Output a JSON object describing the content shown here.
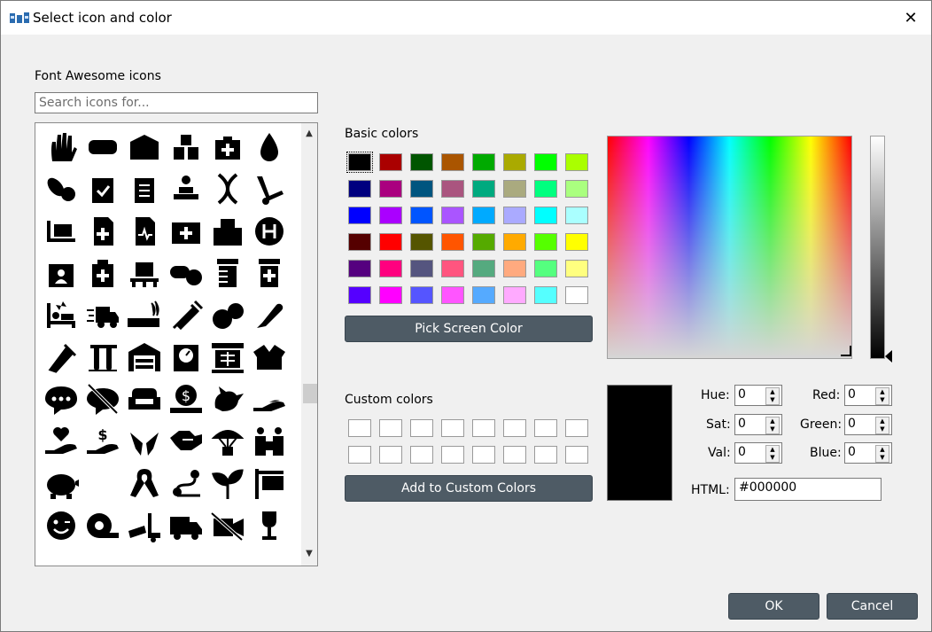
{
  "window": {
    "title": "Select icon and color",
    "close_glyph": "✕"
  },
  "icons_section": {
    "label": "Font Awesome icons",
    "search_placeholder": "Search icons for...",
    "icons": [
      "hand-dots-icon",
      "band-aid-icon",
      "box-icon",
      "boxes-icon",
      "first-aid-kit-icon",
      "tint-icon",
      "capsules-icon",
      "clipboard-check-icon",
      "clipboard-list-icon",
      "diagnoses-icon",
      "dna-icon",
      "dolly-icon",
      "dolly-flatbed-icon",
      "file-medical-icon",
      "file-medical-alt-icon",
      "first-aid-icon",
      "hospital-icon",
      "hospital-symbol-icon",
      "id-card-alt-icon",
      "notes-medical-icon",
      "pallet-icon",
      "pills-icon",
      "prescription-bottle-icon",
      "prescription-bottle-alt-icon",
      "procedures-icon",
      "shipping-fast-icon",
      "smoking-icon",
      "syringe-icon",
      "tablets-icon",
      "thermometer-icon",
      "vial-icon",
      "vials-icon",
      "warehouse-icon",
      "weight-icon",
      "x-ray-icon",
      "box-open-icon",
      "comment-dots-icon",
      "comment-slash-icon",
      "couch-icon",
      "donate-icon",
      "dove-icon",
      "hand-holding-icon",
      "hand-holding-heart-icon",
      "hand-holding-usd-icon",
      "hands-icon",
      "handshake-icon",
      "parachute-box-icon",
      "people-carry-icon",
      "piggy-bank-icon",
      "blank-icon",
      "ribbon-icon",
      "route-icon",
      "seedling-icon",
      "sign-icon",
      "smile-wink-icon",
      "tape-icon",
      "truck-loading-icon",
      "truck-moving-icon",
      "video-slash-icon",
      "wine-glass-icon"
    ],
    "scroll_up": "▲",
    "scroll_down": "▼"
  },
  "basic_colors": {
    "label": "Basic colors",
    "colors": [
      [
        "#000000",
        "#aa0000",
        "#005500",
        "#aa5500",
        "#00aa00",
        "#aaaa00",
        "#00ff00",
        "#aaff00"
      ],
      [
        "#00007f",
        "#aa007f",
        "#00557f",
        "#aa557f",
        "#00aa7f",
        "#aaaa7f",
        "#00ff7f",
        "#aaff7f"
      ],
      [
        "#0000ff",
        "#aa00ff",
        "#0055ff",
        "#aa55ff",
        "#00aaff",
        "#aaaaff",
        "#00ffff",
        "#aaffff"
      ],
      [
        "#550000",
        "#ff0000",
        "#555500",
        "#ff5500",
        "#55aa00",
        "#ffaa00",
        "#55ff00",
        "#ffff00"
      ],
      [
        "#55007f",
        "#ff007f",
        "#55557f",
        "#ff557f",
        "#55aa7f",
        "#ffaa7f",
        "#55ff7f",
        "#ffff7f"
      ],
      [
        "#5500ff",
        "#ff00ff",
        "#5555ff",
        "#ff55ff",
        "#55aaff",
        "#ffaaff",
        "#55ffff",
        "#ffffff"
      ]
    ],
    "selected": "#000000"
  },
  "pick_screen_color_label": "Pick Screen Color",
  "custom_colors": {
    "label": "Custom colors",
    "rows": 2,
    "cols": 8
  },
  "add_custom_label": "Add to Custom Colors",
  "fields": {
    "hue": {
      "label": "Hue:",
      "value": "0"
    },
    "sat": {
      "label": "Sat:",
      "value": "0"
    },
    "val": {
      "label": "Val:",
      "value": "0"
    },
    "red": {
      "label": "Red:",
      "value": "0"
    },
    "green": {
      "label": "Green:",
      "value": "0"
    },
    "blue": {
      "label": "Blue:",
      "value": "0"
    },
    "html": {
      "label": "HTML:",
      "value": "#000000"
    }
  },
  "current_color": "#000000",
  "buttons": {
    "ok": "OK",
    "cancel": "Cancel"
  }
}
